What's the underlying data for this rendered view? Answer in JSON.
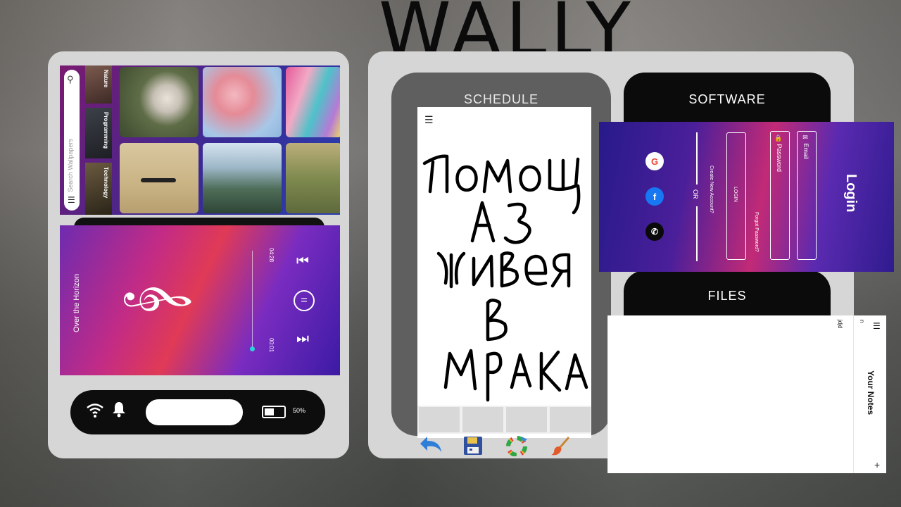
{
  "app_title": "WALLY",
  "wallpapers": {
    "search_placeholder": "Search Wallpapers",
    "categories": [
      "Nature",
      "Programming",
      "Technology"
    ]
  },
  "music": {
    "track_title": "Over the Horizon",
    "duration": "04:28",
    "current_time": "00:01"
  },
  "status_bar": {
    "battery_percent": "50%"
  },
  "home_tiles": {
    "schedule": "SCHEDULE",
    "software": "SOFTWARE",
    "files": "FILES"
  },
  "drawing": {
    "handwriting_lines": [
      "помощ",
      "аз",
      "живея",
      "в",
      "мрака"
    ],
    "tools": [
      "back-arrow-icon",
      "save-icon",
      "color-wheel-icon",
      "brush-icon"
    ]
  },
  "login": {
    "title": "Login",
    "email_label": "Email",
    "password_label": "Password",
    "login_button": "LOGIN",
    "forgot_password": "Forgot Password?",
    "create_account": "Create New Account?",
    "or_text": "OR"
  },
  "notes": {
    "title": "Your Notes",
    "items": [
      "n",
      "jdjd"
    ],
    "add_symbol": "+"
  }
}
